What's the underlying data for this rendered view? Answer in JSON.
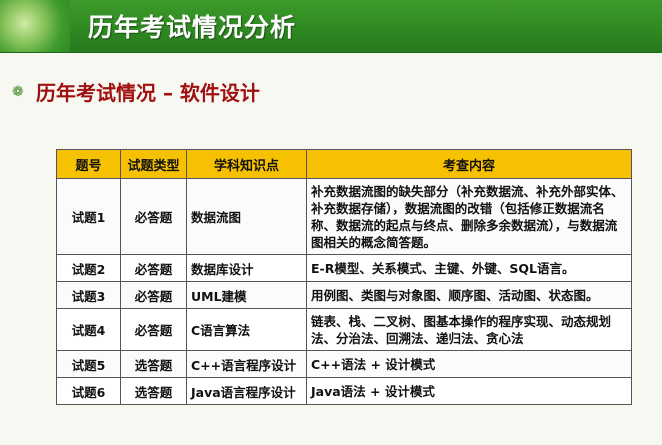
{
  "header": {
    "title": "历年考试情况分析"
  },
  "section": {
    "bullet_icon": "gear-flower-icon",
    "subtitle": "历年考试情况 – 软件设计"
  },
  "table": {
    "headers": [
      "题号",
      "试题类型",
      "学科知识点",
      "考查内容"
    ],
    "header_color": "#f5c100",
    "rows": [
      {
        "no": "试题1",
        "type": "必答题",
        "topic": "数据流图",
        "content": "补充数据流图的缺失部分（补充数据流、补充外部实体、补充数据存储），数据流图的改错（包括修正数据流名称、数据流的起点与终点、删除多余数据流），与数据流图相关的概念简答题。"
      },
      {
        "no": "试题2",
        "type": "必答题",
        "topic": "数据库设计",
        "content": "E-R模型、关系模式、主键、外键、SQL语言。"
      },
      {
        "no": "试题3",
        "type": "必答题",
        "topic": "UML建模",
        "content": "用例图、类图与对象图、顺序图、活动图、状态图。"
      },
      {
        "no": "试题4",
        "type": "必答题",
        "topic": "C语言算法",
        "content": "链表、栈、二叉树、图基本操作的程序实现、动态规划法、分治法、回溯法、递归法、贪心法"
      },
      {
        "no": "试题5",
        "type": "选答题",
        "topic": "C++语言程序设计",
        "content": "C++语法 + 设计模式"
      },
      {
        "no": "试题6",
        "type": "选答题",
        "topic": "Java语言程序设计",
        "content": "Java语法 + 设计模式"
      }
    ]
  }
}
